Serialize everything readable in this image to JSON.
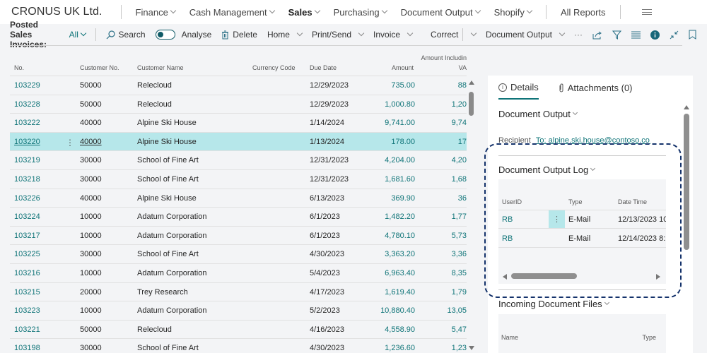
{
  "topnav": {
    "brand": "CRONUS UK Ltd.",
    "items": [
      {
        "label": "Finance",
        "active": false
      },
      {
        "label": "Cash Management",
        "active": false
      },
      {
        "label": "Sales",
        "active": true
      },
      {
        "label": "Purchasing",
        "active": false
      },
      {
        "label": "Document Output",
        "active": false
      },
      {
        "label": "Shopify",
        "active": false
      }
    ],
    "all_reports": "All Reports",
    "menu_icon": "hamburger-icon"
  },
  "actionbar": {
    "page_title": "Posted Sales Invoices:",
    "filter": "All",
    "search": "Search",
    "analyse": "Analyse",
    "analyse_on": false,
    "delete": "Delete",
    "home": "Home",
    "print_send": "Print/Send",
    "invoice": "Invoice",
    "correct": "Correct",
    "document_output": "Document Output",
    "more": "···",
    "icons": [
      "share-icon",
      "filter-icon",
      "list-view-icon",
      "info-icon",
      "collapse-icon",
      "bookmark-icon"
    ]
  },
  "table": {
    "columns": {
      "no": "No.",
      "customer_no": "Customer No.",
      "customer_name": "Customer Name",
      "currency_code": "Currency Code",
      "due_date": "Due Date",
      "amount": "Amount",
      "amount_incl_vat_line1": "Amount Includin",
      "amount_incl_vat_line2": "VA"
    },
    "rows": [
      {
        "no": "103229",
        "customer_no": "50000",
        "name": "Relecloud",
        "currency": "",
        "due": "12/29/2023",
        "amount": "735.00",
        "amount_vat": "88",
        "selected": false
      },
      {
        "no": "103228",
        "customer_no": "50000",
        "name": "Relecloud",
        "currency": "",
        "due": "12/29/2023",
        "amount": "1,000.80",
        "amount_vat": "1,20",
        "selected": false
      },
      {
        "no": "103222",
        "customer_no": "40000",
        "name": "Alpine Ski House",
        "currency": "",
        "due": "1/14/2024",
        "amount": "9,741.00",
        "amount_vat": "9,74",
        "selected": false
      },
      {
        "no": "103220",
        "customer_no": "40000",
        "name": "Alpine Ski House",
        "currency": "",
        "due": "1/13/2024",
        "amount": "178.00",
        "amount_vat": "17",
        "selected": true
      },
      {
        "no": "103219",
        "customer_no": "30000",
        "name": "School of Fine Art",
        "currency": "",
        "due": "12/31/2023",
        "amount": "4,204.00",
        "amount_vat": "4,20",
        "selected": false
      },
      {
        "no": "103218",
        "customer_no": "30000",
        "name": "School of Fine Art",
        "currency": "",
        "due": "12/31/2023",
        "amount": "1,681.60",
        "amount_vat": "1,68",
        "selected": false
      },
      {
        "no": "103226",
        "customer_no": "40000",
        "name": "Alpine Ski House",
        "currency": "",
        "due": "6/13/2023",
        "amount": "369.90",
        "amount_vat": "36",
        "selected": false
      },
      {
        "no": "103224",
        "customer_no": "10000",
        "name": "Adatum Corporation",
        "currency": "",
        "due": "6/1/2023",
        "amount": "1,482.20",
        "amount_vat": "1,77",
        "selected": false
      },
      {
        "no": "103217",
        "customer_no": "10000",
        "name": "Adatum Corporation",
        "currency": "",
        "due": "6/1/2023",
        "amount": "4,780.10",
        "amount_vat": "5,73",
        "selected": false
      },
      {
        "no": "103225",
        "customer_no": "30000",
        "name": "School of Fine Art",
        "currency": "",
        "due": "4/30/2023",
        "amount": "3,363.20",
        "amount_vat": "3,36",
        "selected": false
      },
      {
        "no": "103216",
        "customer_no": "10000",
        "name": "Adatum Corporation",
        "currency": "",
        "due": "5/4/2023",
        "amount": "6,963.40",
        "amount_vat": "8,35",
        "selected": false
      },
      {
        "no": "103215",
        "customer_no": "20000",
        "name": "Trey Research",
        "currency": "",
        "due": "4/17/2023",
        "amount": "1,619.40",
        "amount_vat": "1,79",
        "selected": false
      },
      {
        "no": "103223",
        "customer_no": "10000",
        "name": "Adatum Corporation",
        "currency": "",
        "due": "5/2/2023",
        "amount": "10,880.40",
        "amount_vat": "13,05",
        "selected": false
      },
      {
        "no": "103221",
        "customer_no": "50000",
        "name": "Relecloud",
        "currency": "",
        "due": "4/16/2023",
        "amount": "4,558.90",
        "amount_vat": "5,47",
        "selected": false
      },
      {
        "no": "103198",
        "customer_no": "30000",
        "name": "School of Fine Art",
        "currency": "",
        "due": "4/30/2023",
        "amount": "1,236.60",
        "amount_vat": "1,23",
        "selected": false
      }
    ],
    "row_menu": "⋮"
  },
  "factbox": {
    "tabs": [
      {
        "label": "Details",
        "active": true,
        "icon": "info-circle-icon"
      },
      {
        "label": "Attachments (0)",
        "active": false,
        "icon": "paperclip-icon"
      }
    ],
    "document_output": {
      "title": "Document Output",
      "recipient_label": "Recipient",
      "recipient_value": "To: alpine.ski.house@contoso.co..."
    },
    "output_log": {
      "title": "Document Output Log",
      "columns": {
        "user": "UserID",
        "type": "Type",
        "datetime": "Date Time"
      },
      "rows": [
        {
          "user": "RB",
          "type": "E-Mail",
          "datetime": "12/13/2023 10",
          "selected": true
        },
        {
          "user": "RB",
          "type": "E-Mail",
          "datetime": "12/14/2023 8:",
          "selected": false
        }
      ]
    },
    "incoming_files": {
      "title": "Incoming Document Files",
      "columns": {
        "name": "Name",
        "type": "Type"
      }
    }
  },
  "colors": {
    "accent": "#0f7478",
    "selected_row": "#b6e7ea",
    "highlight_border": "#14326b"
  }
}
